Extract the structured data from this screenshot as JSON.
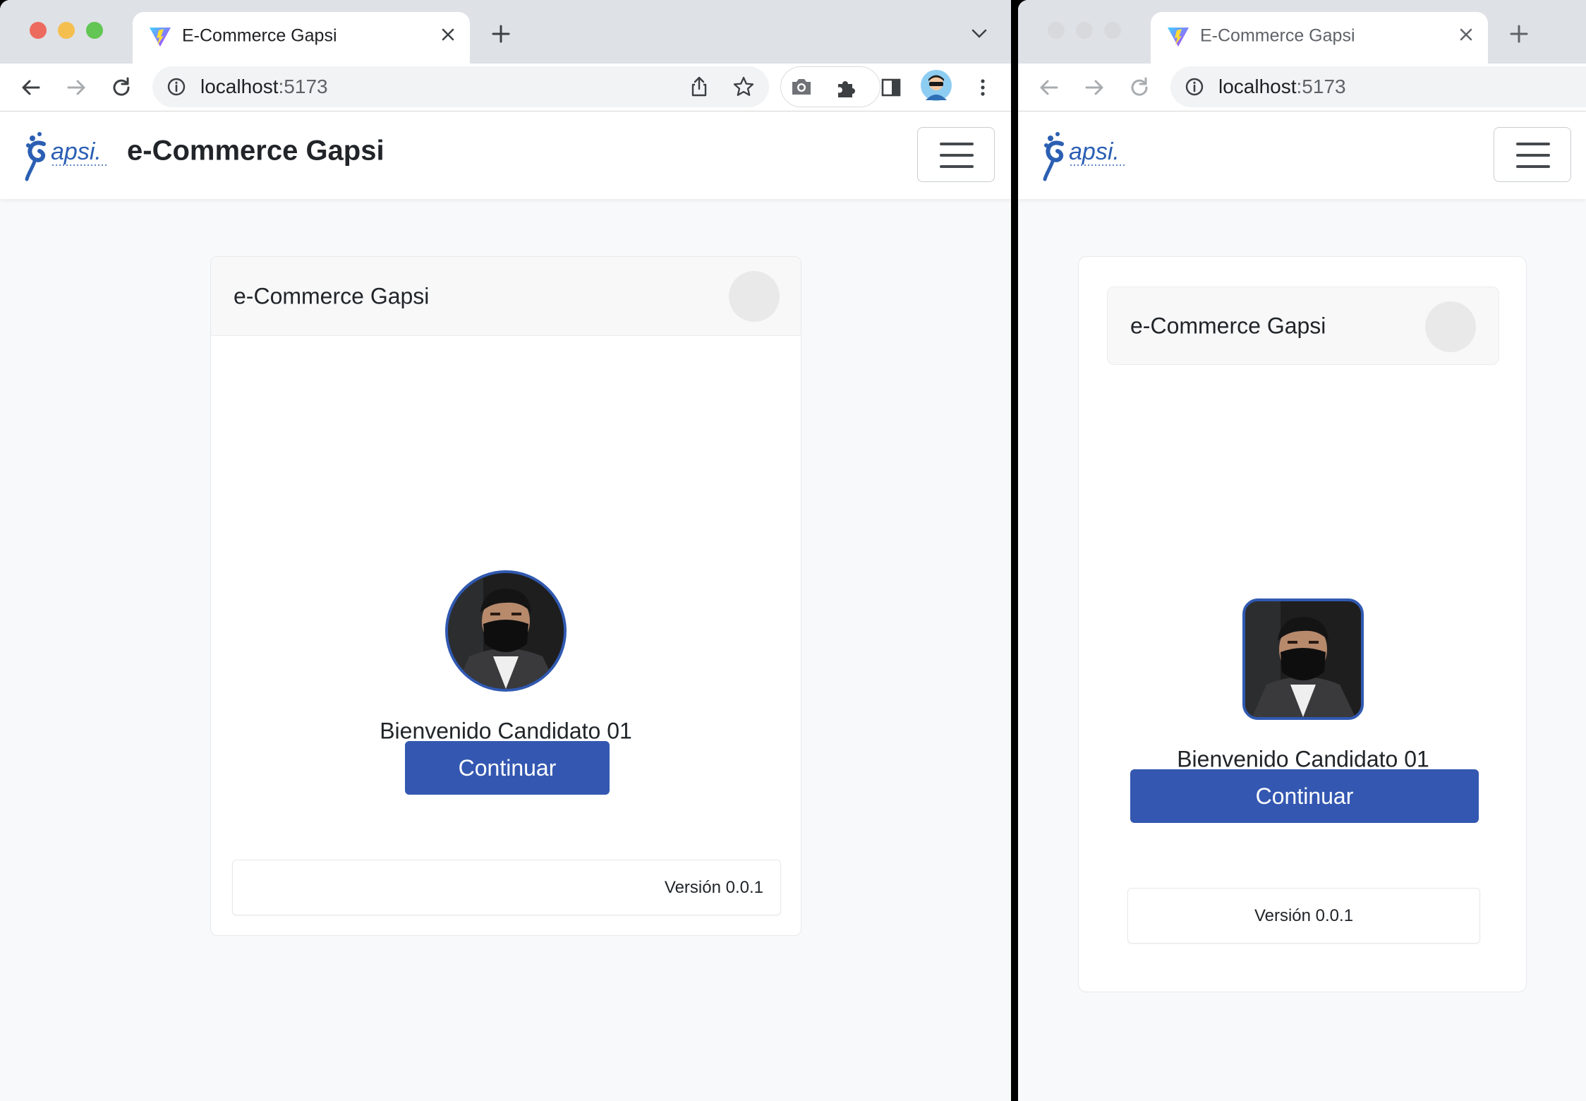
{
  "browser": {
    "tab_title": "E-Commerce Gapsi",
    "url_host": "localhost",
    "url_port": ":5173"
  },
  "navbar": {
    "brand_title": "e-Commerce Gapsi",
    "logo_text": "apsi."
  },
  "card": {
    "header_title": "e-Commerce Gapsi",
    "welcome_text": "Bienvenido Candidato 01",
    "continue_label": "Continuar",
    "version_text": "Versión 0.0.1"
  },
  "colors": {
    "primary": "#3458b1",
    "avatar_border": "#3059b0",
    "tab_strip": "#dee1e6"
  },
  "icons": [
    "vite-favicon",
    "close-icon",
    "plus-icon",
    "chevron-down-icon",
    "back-icon",
    "forward-icon",
    "reload-icon",
    "info-icon",
    "share-icon",
    "star-icon",
    "camera-icon",
    "puzzle-icon",
    "sidepanel-icon",
    "profile-avatar",
    "kebab-menu-icon",
    "hamburger-icon"
  ]
}
